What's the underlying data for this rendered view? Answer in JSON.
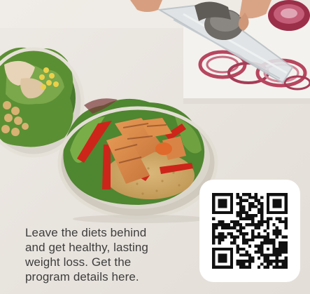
{
  "promo": {
    "text": "Leave the diets behind\nand get healthy, lasting\nweight loss. Get the\nprogram details here."
  },
  "photo": {
    "subject": "salmon-and-quinoa-salad-bowls-with-onion-slicer"
  },
  "qr": {
    "icon": "qr-code-icon"
  },
  "colors": {
    "background": "#ece8e2",
    "text": "#3e3e3e",
    "qr_card": "#ffffff",
    "qr_modules": "#111111",
    "salmon": "#d9894a",
    "red_pepper": "#c9231a",
    "greens": "#4b7d2a",
    "quinoa": "#cfa867",
    "red_onion": "#b7465f",
    "bowl_rim": "#dcd7cf"
  }
}
